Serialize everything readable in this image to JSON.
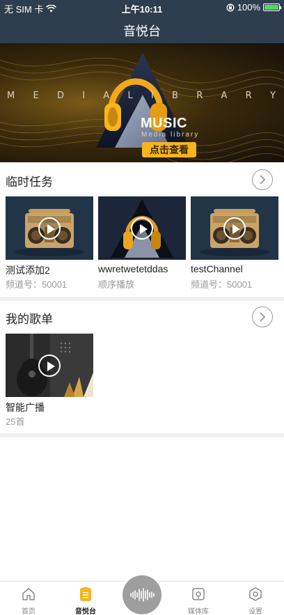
{
  "status_bar": {
    "carrier": "无 SIM 卡",
    "time": "上午10:11",
    "battery": "100%"
  },
  "nav": {
    "title": "音悦台"
  },
  "banner": {
    "letters": [
      "M",
      "E",
      "D",
      "I",
      "A",
      "L",
      "I",
      "B",
      "R",
      "A",
      "R",
      "Y"
    ],
    "music_title": "MUSIC",
    "music_subtitle": "Media library",
    "button_label": "点击查看"
  },
  "temp_tasks": {
    "title": "临时任务",
    "items": [
      {
        "title": "测试添加2",
        "subtitle": "频道号：50001",
        "thumb": "radio"
      },
      {
        "title": "wwretwetetddas",
        "subtitle": "顺序播放",
        "thumb": "headphones"
      },
      {
        "title": "testChannel",
        "subtitle": "频道号：50001",
        "thumb": "radio"
      }
    ]
  },
  "my_playlists": {
    "title": "我的歌单",
    "items": [
      {
        "title": "智能广播",
        "subtitle": "25首",
        "thumb": "guitar"
      }
    ]
  },
  "tabbar": {
    "items": [
      {
        "label": "首页",
        "icon": "home-icon",
        "active": false
      },
      {
        "label": "音悦台",
        "icon": "playlist-icon",
        "active": true
      },
      {
        "label": "媒体库",
        "icon": "media-library-icon",
        "active": false
      },
      {
        "label": "设置",
        "icon": "settings-icon",
        "active": false
      }
    ],
    "center_icon": "waveform-icon"
  },
  "colors": {
    "nav_bg": "#2f3e4e",
    "accent": "#f5b51e",
    "battery": "#4cd964"
  }
}
